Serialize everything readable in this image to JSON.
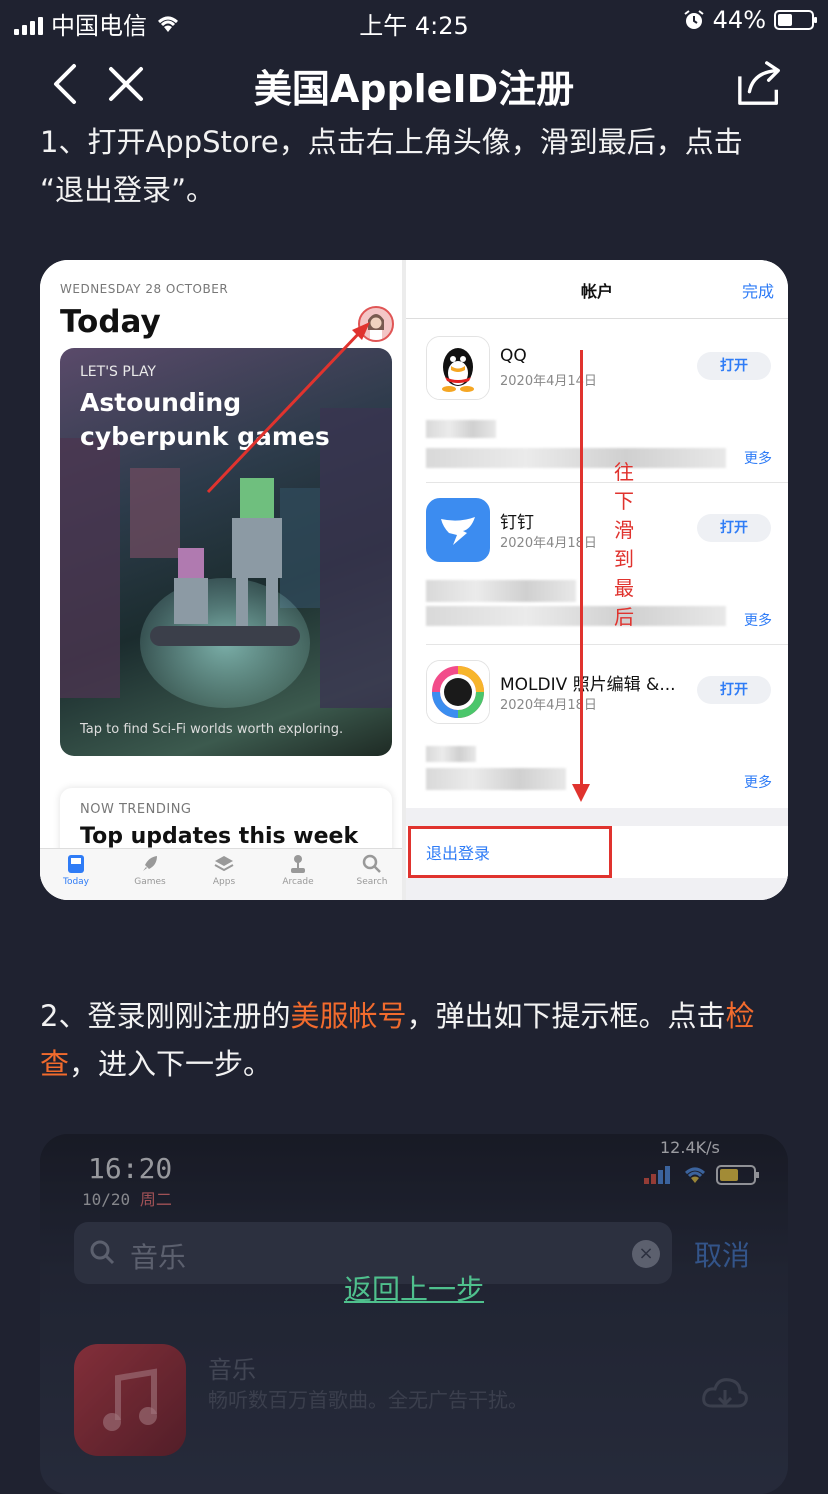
{
  "status_bar": {
    "carrier": "中国电信",
    "time": "上午 4:25",
    "battery": "44%"
  },
  "nav": {
    "title": "美国AppleID注册"
  },
  "step1": {
    "line1": "1、打开AppStore，点击右上角头像，滑到最后，点击",
    "line2": "“退出登录”。"
  },
  "screenshot1": {
    "date": "WEDNESDAY 28 OCTOBER",
    "today": "Today",
    "card_subtitle": "LET'S PLAY",
    "card_title_1": "Astounding",
    "card_title_2": "cyberpunk games",
    "card_caption": "Tap to find Sci-Fi worlds worth exploring.",
    "trending_subtitle": "NOW TRENDING",
    "trending_title": "Top updates this week",
    "tabs": [
      "Today",
      "Games",
      "Apps",
      "Arcade",
      "Search"
    ],
    "account_title": "帐户",
    "done": "完成",
    "apps": [
      {
        "name": "QQ",
        "date": "2020年4月14日",
        "button": "打开"
      },
      {
        "name": "钉钉",
        "date": "2020年4月18日",
        "button": "打开"
      },
      {
        "name": "MOLDIV 照片编辑 &...",
        "date": "2020年4月18日",
        "button": "打开"
      }
    ],
    "more": "更多",
    "annotation": "往下滑到最后",
    "logout": "退出登录"
  },
  "step2": {
    "prefix": "2、登录刚刚注册的",
    "highlight1": "美服帐号",
    "middle": "，弹出如下提示框。点击",
    "highlight2a": "检",
    "highlight2b": "查",
    "suffix": "，进入下一步。"
  },
  "screenshot2": {
    "time": "16:20",
    "date": "10/20",
    "weekday": "周二",
    "speed": "12.4K/s",
    "search_text": "音乐",
    "cancel": "取消",
    "back_link": "返回上一步",
    "app_name": "音乐",
    "app_desc": "畅听数百万首歌曲。全无广告干扰。"
  },
  "colors": {
    "background": "#1f2230",
    "highlight": "#f26b2d",
    "link_green": "#4fc08d",
    "ios_blue": "#2f7cf6",
    "annotation_red": "#e0332e"
  }
}
